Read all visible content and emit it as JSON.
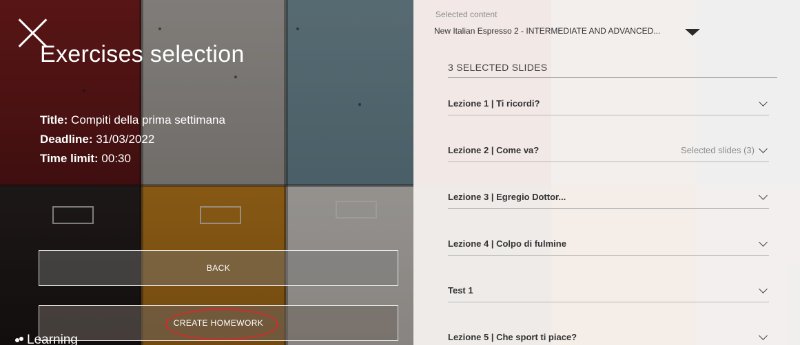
{
  "left_panel": {
    "title": "Exercises selection",
    "info": [
      {
        "label": "Title:",
        "value": " Compiti della prima settimana"
      },
      {
        "label": "Deadline:",
        "value": " 31/03/2022"
      },
      {
        "label": "Time limit:",
        "value": " 00:30"
      }
    ],
    "buttons": {
      "back": "BACK",
      "create": "CREATE HOMEWORK"
    },
    "brand": "Learning",
    "highlight_color": "#d42a2a"
  },
  "right_panel": {
    "selected_label": "Selected content",
    "selected_value": "New Italian Espresso 2 - INTERMEDIATE AND ADVANCED...",
    "slides_header": "3 SELECTED SLIDES",
    "lessons": [
      {
        "name": "Lezione 1 | Ti ricordi?",
        "count": ""
      },
      {
        "name": "Lezione 2 | Come va?",
        "count": "Selected slides (3)"
      },
      {
        "name": "Lezione 3 | Egregio Dottor...",
        "count": ""
      },
      {
        "name": "Lezione 4 | Colpo di fulmine",
        "count": ""
      },
      {
        "name": "Test 1",
        "count": ""
      },
      {
        "name": "Lezione 5 | Che sport ti piace?",
        "count": ""
      }
    ]
  },
  "icons": {
    "close": "close-icon",
    "dropdown": "caret-down-icon",
    "lesson_toggle": "chevron-down-icon",
    "brand": "brand-logo-icon"
  }
}
